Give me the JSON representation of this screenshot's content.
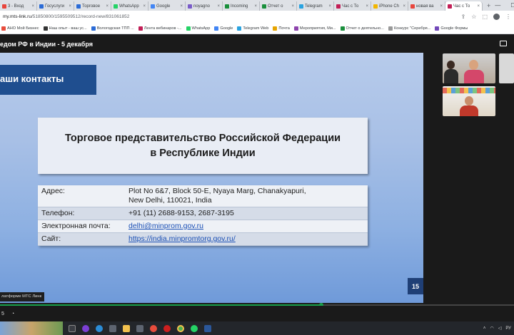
{
  "browser": {
    "tabs": [
      {
        "label": "3 - Вход",
        "color": "#e8453c"
      },
      {
        "label": "Госуслуги",
        "color": "#2b6bd6"
      },
      {
        "label": "Торговое",
        "color": "#2b6bd6"
      },
      {
        "label": "WhatsApp",
        "color": "#25d366"
      },
      {
        "label": "Google",
        "color": "#4285f4"
      },
      {
        "label": "noyagno",
        "color": "#7a5cc9"
      },
      {
        "label": "Incoming",
        "color": "#1a8f3c"
      },
      {
        "label": "Отчет о",
        "color": "#1a8f3c"
      },
      {
        "label": "Telegram",
        "color": "#2aa3e0"
      },
      {
        "label": "Час с То",
        "color": "#c21e56"
      },
      {
        "label": "iPhone Ch",
        "color": "#f2b600"
      },
      {
        "label": "новая ва",
        "color": "#e8453c"
      },
      {
        "label": "Час с То",
        "color": "#c21e56",
        "active": true
      }
    ],
    "new_tab": "+",
    "window_controls": [
      "—",
      "☐",
      "✕"
    ],
    "url_host": "my.mts-link.ru",
    "url_path": "/51850800/1595509512/record-new/831061852",
    "bookmarks": [
      {
        "label": "АНО Мой Бизнес",
        "color": "#e74c3c"
      },
      {
        "label": "Наш опыт - ваш ус...",
        "color": "#333"
      },
      {
        "label": "Вологодская ТПП ...",
        "color": "#2b6bd6"
      },
      {
        "label": "Лента вебинаров -...",
        "color": "#c21e56"
      },
      {
        "label": "WhatsApp",
        "color": "#25d366"
      },
      {
        "label": "Google",
        "color": "#4285f4"
      },
      {
        "label": "Telegram Web",
        "color": "#2aa3e0"
      },
      {
        "label": "Почта",
        "color": "#e6a400"
      },
      {
        "label": "Мероприятия, Ми...",
        "color": "#8e44ad"
      },
      {
        "label": "Отчет о деятельно...",
        "color": "#1a8f3c"
      },
      {
        "label": "Конкурс \"Серебря...",
        "color": "#999"
      },
      {
        "label": "Google Формы",
        "color": "#7248b9"
      }
    ]
  },
  "meeting": {
    "title": "едом РФ в Индии - 5 декабря"
  },
  "slide": {
    "band_title": "аши контакты",
    "heading_line1": "Торговое представительство Российской Федерации",
    "heading_line2": "в Республике Индии",
    "rows": [
      {
        "key": "Адрес:",
        "value": "Plot No 6&7, Block 50-E, Nyaya Marg, Chanakyapuri,",
        "value2": "New Delhi, 110021, India"
      },
      {
        "key": "Телефон:",
        "value": "+91 (11) 2688-9153, 2687-3195"
      },
      {
        "key": "Электронная почта:",
        "value": "delhi@minprom.gov.ru",
        "link": true
      },
      {
        "key": "Сайт:",
        "value": "https://india.minpromtorg.gov.ru/",
        "link": true
      }
    ],
    "page_number": "15"
  },
  "player": {
    "share_label": "латформе МТС Линк",
    "time": "5",
    "progress": 0.625
  },
  "taskbar": {
    "tray_text": "РУ"
  }
}
